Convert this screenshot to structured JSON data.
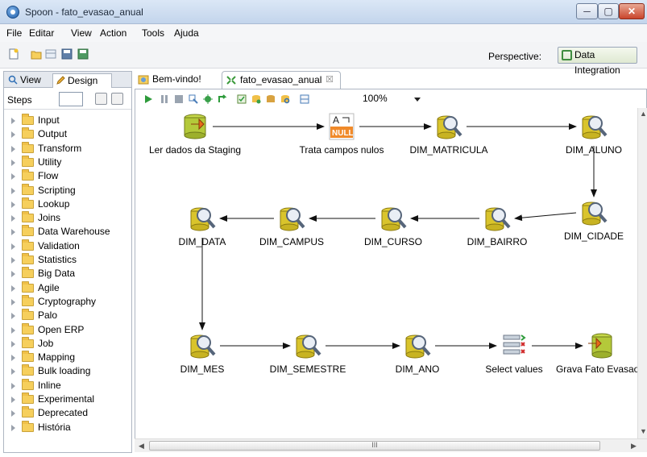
{
  "window": {
    "title": "Spoon - fato_evasao_anual",
    "minimize": "─",
    "maximize": "▢",
    "close": "✕"
  },
  "menu": [
    "File",
    "Editar",
    "View",
    "Action",
    "Tools",
    "Ajuda"
  ],
  "perspective": {
    "label": "Perspective:",
    "value": "Data Integration"
  },
  "left_panel": {
    "tab_view": "View",
    "tab_design": "Design",
    "steps_label": "Steps",
    "categories": [
      "Input",
      "Output",
      "Transform",
      "Utility",
      "Flow",
      "Scripting",
      "Lookup",
      "Joins",
      "Data Warehouse",
      "Validation",
      "Statistics",
      "Big Data",
      "Agile",
      "Cryptography",
      "Palo",
      "Open ERP",
      "Job",
      "Mapping",
      "Bulk loading",
      "Inline",
      "Experimental",
      "Deprecated",
      "História"
    ]
  },
  "editor": {
    "tabs": [
      {
        "label": "Bem-vindo!"
      },
      {
        "label": "fato_evasao_anual",
        "close": "☒"
      }
    ],
    "zoom": "100%"
  },
  "nodes": [
    {
      "label": "Ler dados da Staging",
      "icon": "table-input-icon"
    },
    {
      "label": "Trata campos nulos",
      "icon": "null-if-icon"
    },
    {
      "label": "DIM_MATRICULA",
      "icon": "lookup-icon"
    },
    {
      "label": "DIM_ALUNO",
      "icon": "lookup-icon"
    },
    {
      "label": "DIM_CIDADE",
      "icon": "lookup-icon"
    },
    {
      "label": "DIM_BAIRRO",
      "icon": "lookup-icon"
    },
    {
      "label": "DIM_CURSO",
      "icon": "lookup-icon"
    },
    {
      "label": "DIM_CAMPUS",
      "icon": "lookup-icon"
    },
    {
      "label": "DIM_DATA",
      "icon": "lookup-icon"
    },
    {
      "label": "DIM_MES",
      "icon": "lookup-icon"
    },
    {
      "label": "DIM_SEMESTRE",
      "icon": "lookup-icon"
    },
    {
      "label": "DIM_ANO",
      "icon": "lookup-icon"
    },
    {
      "label": "Select values",
      "icon": "select-values-icon"
    },
    {
      "label": "Grava Fato Evasao .",
      "icon": "table-output-icon"
    }
  ],
  "scrollbar_grip": "III"
}
